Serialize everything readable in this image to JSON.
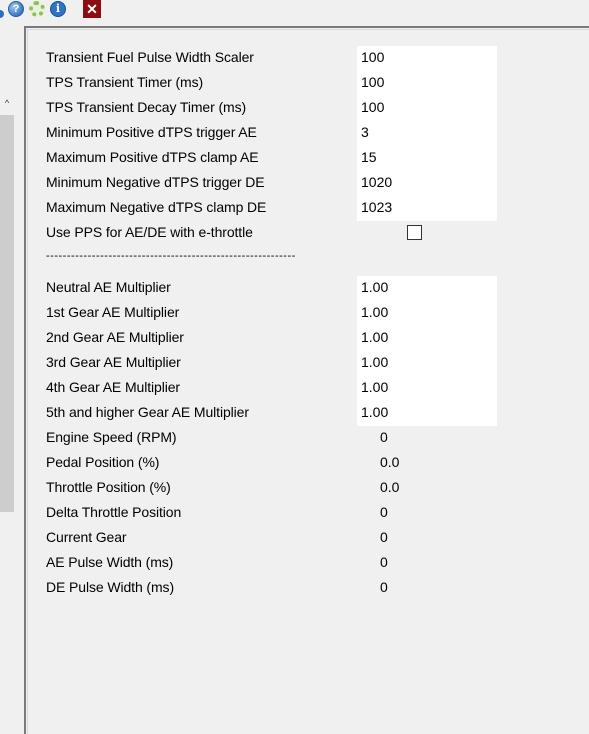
{
  "toolbar": {
    "icons": [
      "help-icon",
      "gear-icon",
      "info-icon",
      "close-icon"
    ],
    "help_glyph": "?",
    "info_glyph": "i",
    "close_glyph": "✕"
  },
  "left_pane": {
    "scroll_up_glyph": "^"
  },
  "params_group1": [
    {
      "label": "Transient Fuel Pulse Width Scaler",
      "value": "100"
    },
    {
      "label": "TPS Transient Timer (ms)",
      "value": "100"
    },
    {
      "label": "TPS Transient Decay Timer (ms)",
      "value": "100"
    },
    {
      "label": "Minimum Positive dTPS trigger AE",
      "value": "3"
    },
    {
      "label": "Maximum Positive dTPS clamp AE",
      "value": "15"
    },
    {
      "label": "Minimum Negative dTPS trigger DE",
      "value": "1020"
    },
    {
      "label": "Maximum Negative dTPS clamp DE",
      "value": "1023"
    }
  ],
  "pps_option": {
    "label": "Use PPS for AE/DE with e-throttle",
    "checked": false
  },
  "separator_text": "------------------------------------------------------------",
  "params_group2": [
    {
      "label": "Neutral AE Multiplier",
      "value": "1.00"
    },
    {
      "label": "1st Gear AE Multiplier",
      "value": "1.00"
    },
    {
      "label": "2nd Gear AE Multiplier",
      "value": "1.00"
    },
    {
      "label": "3rd Gear AE Multiplier",
      "value": "1.00"
    },
    {
      "label": "4th Gear AE Multiplier",
      "value": "1.00"
    },
    {
      "label": "5th and higher Gear AE Multiplier",
      "value": "1.00"
    }
  ],
  "readouts": [
    {
      "label": "Engine Speed (RPM)",
      "value": "0"
    },
    {
      "label": "Pedal Position (%)",
      "value": "0.0"
    },
    {
      "label": "Throttle Position (%)",
      "value": "0.0"
    },
    {
      "label": "Delta Throttle Position",
      "value": "0"
    },
    {
      "label": "Current Gear",
      "value": "0"
    },
    {
      "label": "AE Pulse Width (ms)",
      "value": "0"
    },
    {
      "label": "DE Pulse Width (ms)",
      "value": "0"
    }
  ]
}
